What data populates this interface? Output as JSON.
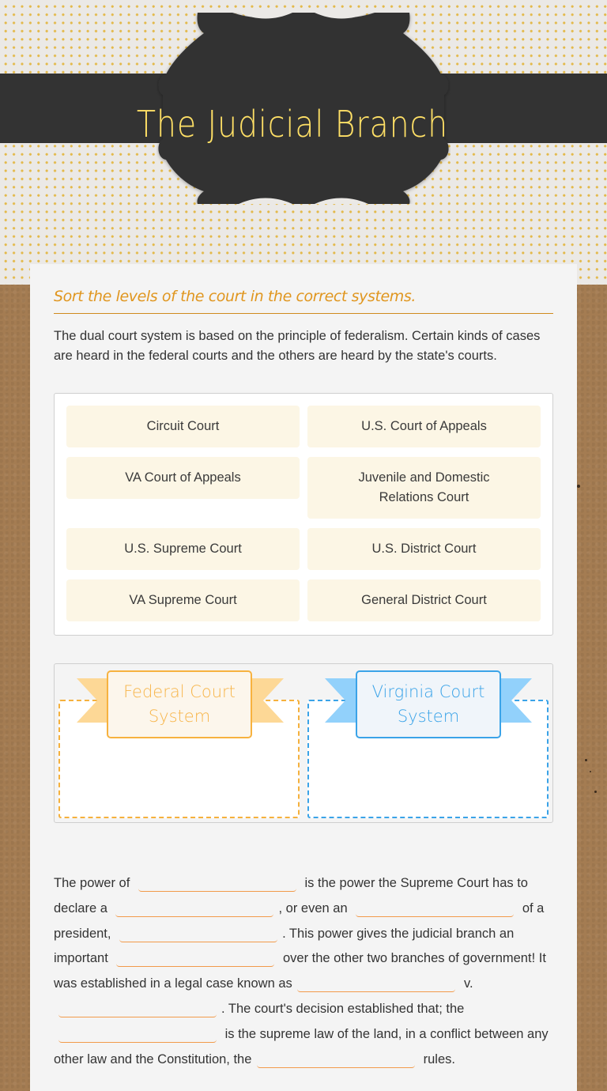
{
  "header": {
    "title": "The Judicial Branch",
    "title_color": "#ffe066",
    "banner_color": "#333333"
  },
  "instructions": "Sort the levels of the court in the correct systems.",
  "intro": "The dual court system is based on the principle of federalism.  Certain kinds of cases are heard in the federal courts and the others are heard by the state's courts.",
  "pool": {
    "items": [
      {
        "label": "Circuit Court"
      },
      {
        "label": "U.S. Court of Appeals"
      },
      {
        "label": "VA Court of Appeals"
      },
      {
        "label": "Juvenile and Domestic Relations Court"
      },
      {
        "label": "U.S. Supreme Court"
      },
      {
        "label": "U.S. District Court"
      },
      {
        "label": "VA Supreme Court"
      },
      {
        "label": "General District Court"
      }
    ]
  },
  "bins": [
    {
      "label": "Federal Court System",
      "color": "#f7b23f"
    },
    {
      "label": "Virginia Court System",
      "color": "#3aa3e8"
    }
  ],
  "cloze": {
    "segments": [
      "The power of",
      "is the power the Supreme Court has to declare a",
      ", or even an",
      "of a president,",
      ". This power gives the judicial branch an important",
      "over the other two branches of government! It was established in a legal case known as",
      "v.",
      ". The court's decision established that; the",
      "is the supreme law of the land, in a conflict between any other law and the Constitution, the",
      "rules."
    ],
    "blank_count": 9,
    "blank_color": "#f29a4a"
  }
}
